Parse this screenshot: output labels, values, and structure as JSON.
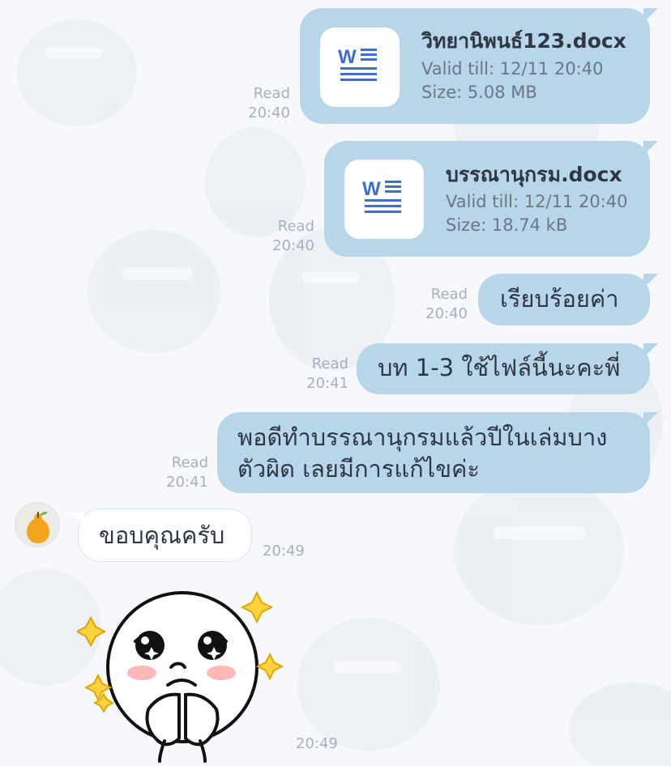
{
  "chat": {
    "messages": [
      {
        "id": "m1",
        "type": "file",
        "read": "Read",
        "time": "20:40",
        "file": {
          "name": "วิทยานิพนธ์123.docx",
          "valid": "Valid till: 12/11 20:40",
          "size": "Size: 5.08 MB",
          "icon": "word-document-icon"
        }
      },
      {
        "id": "m2",
        "type": "file",
        "read": "Read",
        "time": "20:40",
        "file": {
          "name": "บรรณานุกรม.docx",
          "valid": "Valid till: 12/11 20:40",
          "size": "Size: 18.74 kB",
          "icon": "word-document-icon"
        }
      },
      {
        "id": "m3",
        "type": "text",
        "read": "Read",
        "time": "20:40",
        "text": "เรียบร้อยค่า"
      },
      {
        "id": "m4",
        "type": "text",
        "read": "Read",
        "time": "20:41",
        "text": "บท 1-3 ใช้ไฟล์นี้นะคะพี่"
      },
      {
        "id": "m5",
        "type": "text",
        "read": "Read",
        "time": "20:41",
        "lines": [
          "พอดีทำบรรณานุกรมแล้วปีในเล่มบาง",
          "ตัวผิด เลยมีการแก้ไขค่ะ"
        ]
      },
      {
        "id": "m6",
        "type": "text",
        "time": "20:49",
        "text": "ขอบคุณครับ",
        "avatar": "pear-avatar-icon"
      },
      {
        "id": "m7",
        "type": "sticker",
        "time": "20:49",
        "sticker": "crying-face-sticker"
      }
    ]
  }
}
